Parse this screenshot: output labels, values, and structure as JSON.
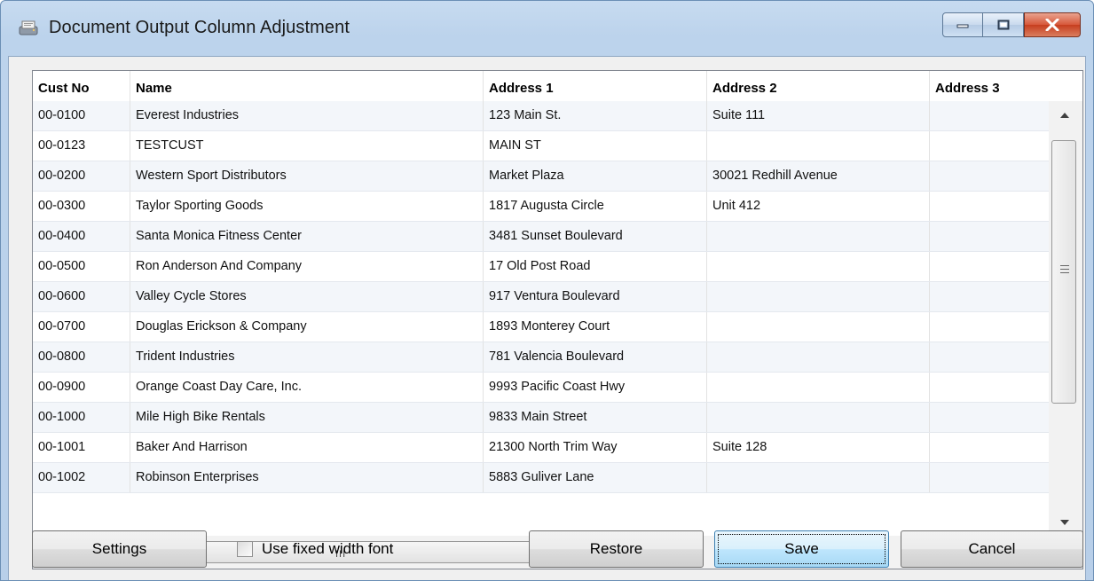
{
  "window": {
    "title": "Document Output Column Adjustment",
    "icons": {
      "app": "app-icon",
      "minimize": "minimize-icon",
      "maximize": "maximize-icon",
      "close": "close-icon"
    }
  },
  "grid": {
    "columns": [
      "Cust No",
      "Name",
      "Address 1",
      "Address 2",
      "Address 3"
    ],
    "rows": [
      [
        "00-0100",
        "Everest Industries",
        "123 Main St.",
        "Suite 111",
        ""
      ],
      [
        "00-0123",
        "TESTCUST",
        "MAIN ST",
        "",
        ""
      ],
      [
        "00-0200",
        "Western Sport Distributors",
        "Market Plaza",
        "30021 Redhill Avenue",
        ""
      ],
      [
        "00-0300",
        "Taylor Sporting Goods",
        "1817 Augusta Circle",
        "Unit 412",
        ""
      ],
      [
        "00-0400",
        "Santa Monica Fitness Center",
        "3481 Sunset Boulevard",
        "",
        ""
      ],
      [
        "00-0500",
        "Ron Anderson And Company",
        "17 Old Post Road",
        "",
        ""
      ],
      [
        "00-0600",
        "Valley Cycle Stores",
        "917 Ventura Boulevard",
        "",
        ""
      ],
      [
        "00-0700",
        "Douglas Erickson & Company",
        "1893 Monterey Court",
        "",
        ""
      ],
      [
        "00-0800",
        "Trident Industries",
        "781 Valencia Boulevard",
        "",
        ""
      ],
      [
        "00-0900",
        "Orange Coast Day Care, Inc.",
        "9993 Pacific Coast Hwy",
        "",
        ""
      ],
      [
        "00-1000",
        "Mile High Bike Rentals",
        "9833 Main Street",
        "",
        ""
      ],
      [
        "00-1001",
        "Baker And Harrison",
        "21300 North Trim Way",
        "Suite 128",
        ""
      ],
      [
        "00-1002",
        "Robinson Enterprises",
        "5883 Guliver Lane",
        "",
        ""
      ]
    ],
    "scrollbar_icons": [
      "scroll-up-icon",
      "scroll-down-icon",
      "scroll-left-icon",
      "scroll-right-icon"
    ]
  },
  "footer": {
    "settings_label": "Settings",
    "fixed_font_label": "Use fixed width font",
    "fixed_font_checked": false,
    "restore_label": "Restore",
    "save_label": "Save",
    "cancel_label": "Cancel"
  }
}
